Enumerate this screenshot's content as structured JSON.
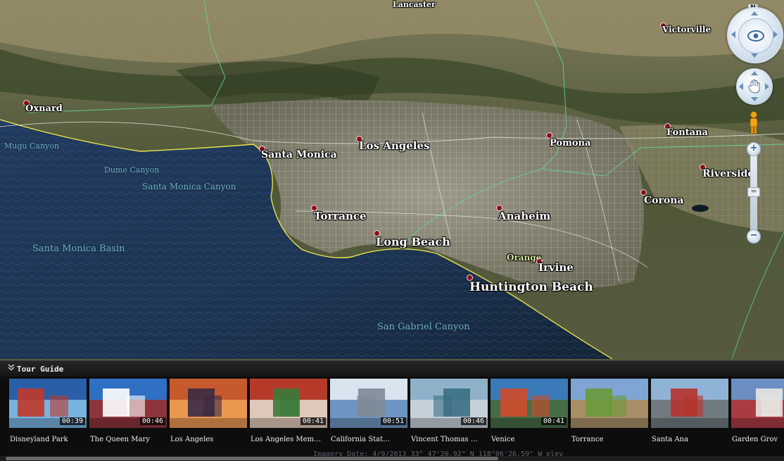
{
  "map": {
    "cities": [
      {
        "name": "Lancaster",
        "size": 11
      },
      {
        "name": "Victorville",
        "size": 12
      },
      {
        "name": "Oxnard",
        "size": 13
      },
      {
        "name": "Santa Monica",
        "size": 14
      },
      {
        "name": "Los Angeles",
        "size": 15
      },
      {
        "name": "Pomona",
        "size": 13
      },
      {
        "name": "Fontana",
        "size": 13
      },
      {
        "name": "Riverside",
        "size": 14
      },
      {
        "name": "Corona",
        "size": 14
      },
      {
        "name": "Torrance",
        "size": 15
      },
      {
        "name": "Anaheim",
        "size": 15
      },
      {
        "name": "Long Beach",
        "size": 16
      },
      {
        "name": "Orange",
        "size": 12
      },
      {
        "name": "Irvine",
        "size": 15
      },
      {
        "name": "Huntington Beach",
        "size": 17
      }
    ],
    "water_labels": [
      "Mugu Canyon",
      "Dume Canyon",
      "Santa Monica Canyon",
      "Santa Monica Basin",
      "San Gabriel Canyon"
    ]
  },
  "navigation": {
    "north_label": "N",
    "zoom_in": "+",
    "zoom_out": "−",
    "slider_thumb": "="
  },
  "tour": {
    "title": "Tour Guide",
    "items": [
      {
        "label": "Disneyland Park",
        "duration": "00:39",
        "palette": [
          "#2a5fa8",
          "#c0392b",
          "#86c1e8"
        ]
      },
      {
        "label": "The Queen Mary",
        "duration": "00:46",
        "palette": [
          "#2f6fc4",
          "#ffffff",
          "#9e2b25"
        ]
      },
      {
        "label": "Los Angeles",
        "duration": "",
        "palette": [
          "#c65a2c",
          "#3a2a45",
          "#f0a257"
        ]
      },
      {
        "label": "Los Angeles Mem…",
        "duration": "00:41",
        "palette": [
          "#b53a2a",
          "#3c7a3a",
          "#e6e0d2"
        ]
      },
      {
        "label": "California Stat…",
        "duration": "00:51",
        "palette": [
          "#d9e4ee",
          "#7e8a96",
          "#5a86b8"
        ]
      },
      {
        "label": "Vincent Thomas …",
        "duration": "00:46",
        "palette": [
          "#8fb1c9",
          "#3b6f84",
          "#cfd6da"
        ]
      },
      {
        "label": "Venice",
        "duration": "00:41",
        "palette": [
          "#3a7ab8",
          "#cf4b2a",
          "#4a6b33"
        ]
      },
      {
        "label": "Torrance",
        "duration": "",
        "palette": [
          "#7ea5d4",
          "#6a9a3a",
          "#b08a54"
        ]
      },
      {
        "label": "Santa Ana",
        "duration": "",
        "palette": [
          "#8fb3d6",
          "#b7332e",
          "#6c7070"
        ]
      },
      {
        "label": "Garden Grov",
        "duration": "",
        "palette": [
          "#6b8fc2",
          "#e8e6e2",
          "#b52d2d"
        ]
      }
    ]
  },
  "status": {
    "ghost_text": "Imagery Date: 4/9/2013   33° 47'20.92\" N 118°06'26.59\" W elev"
  }
}
